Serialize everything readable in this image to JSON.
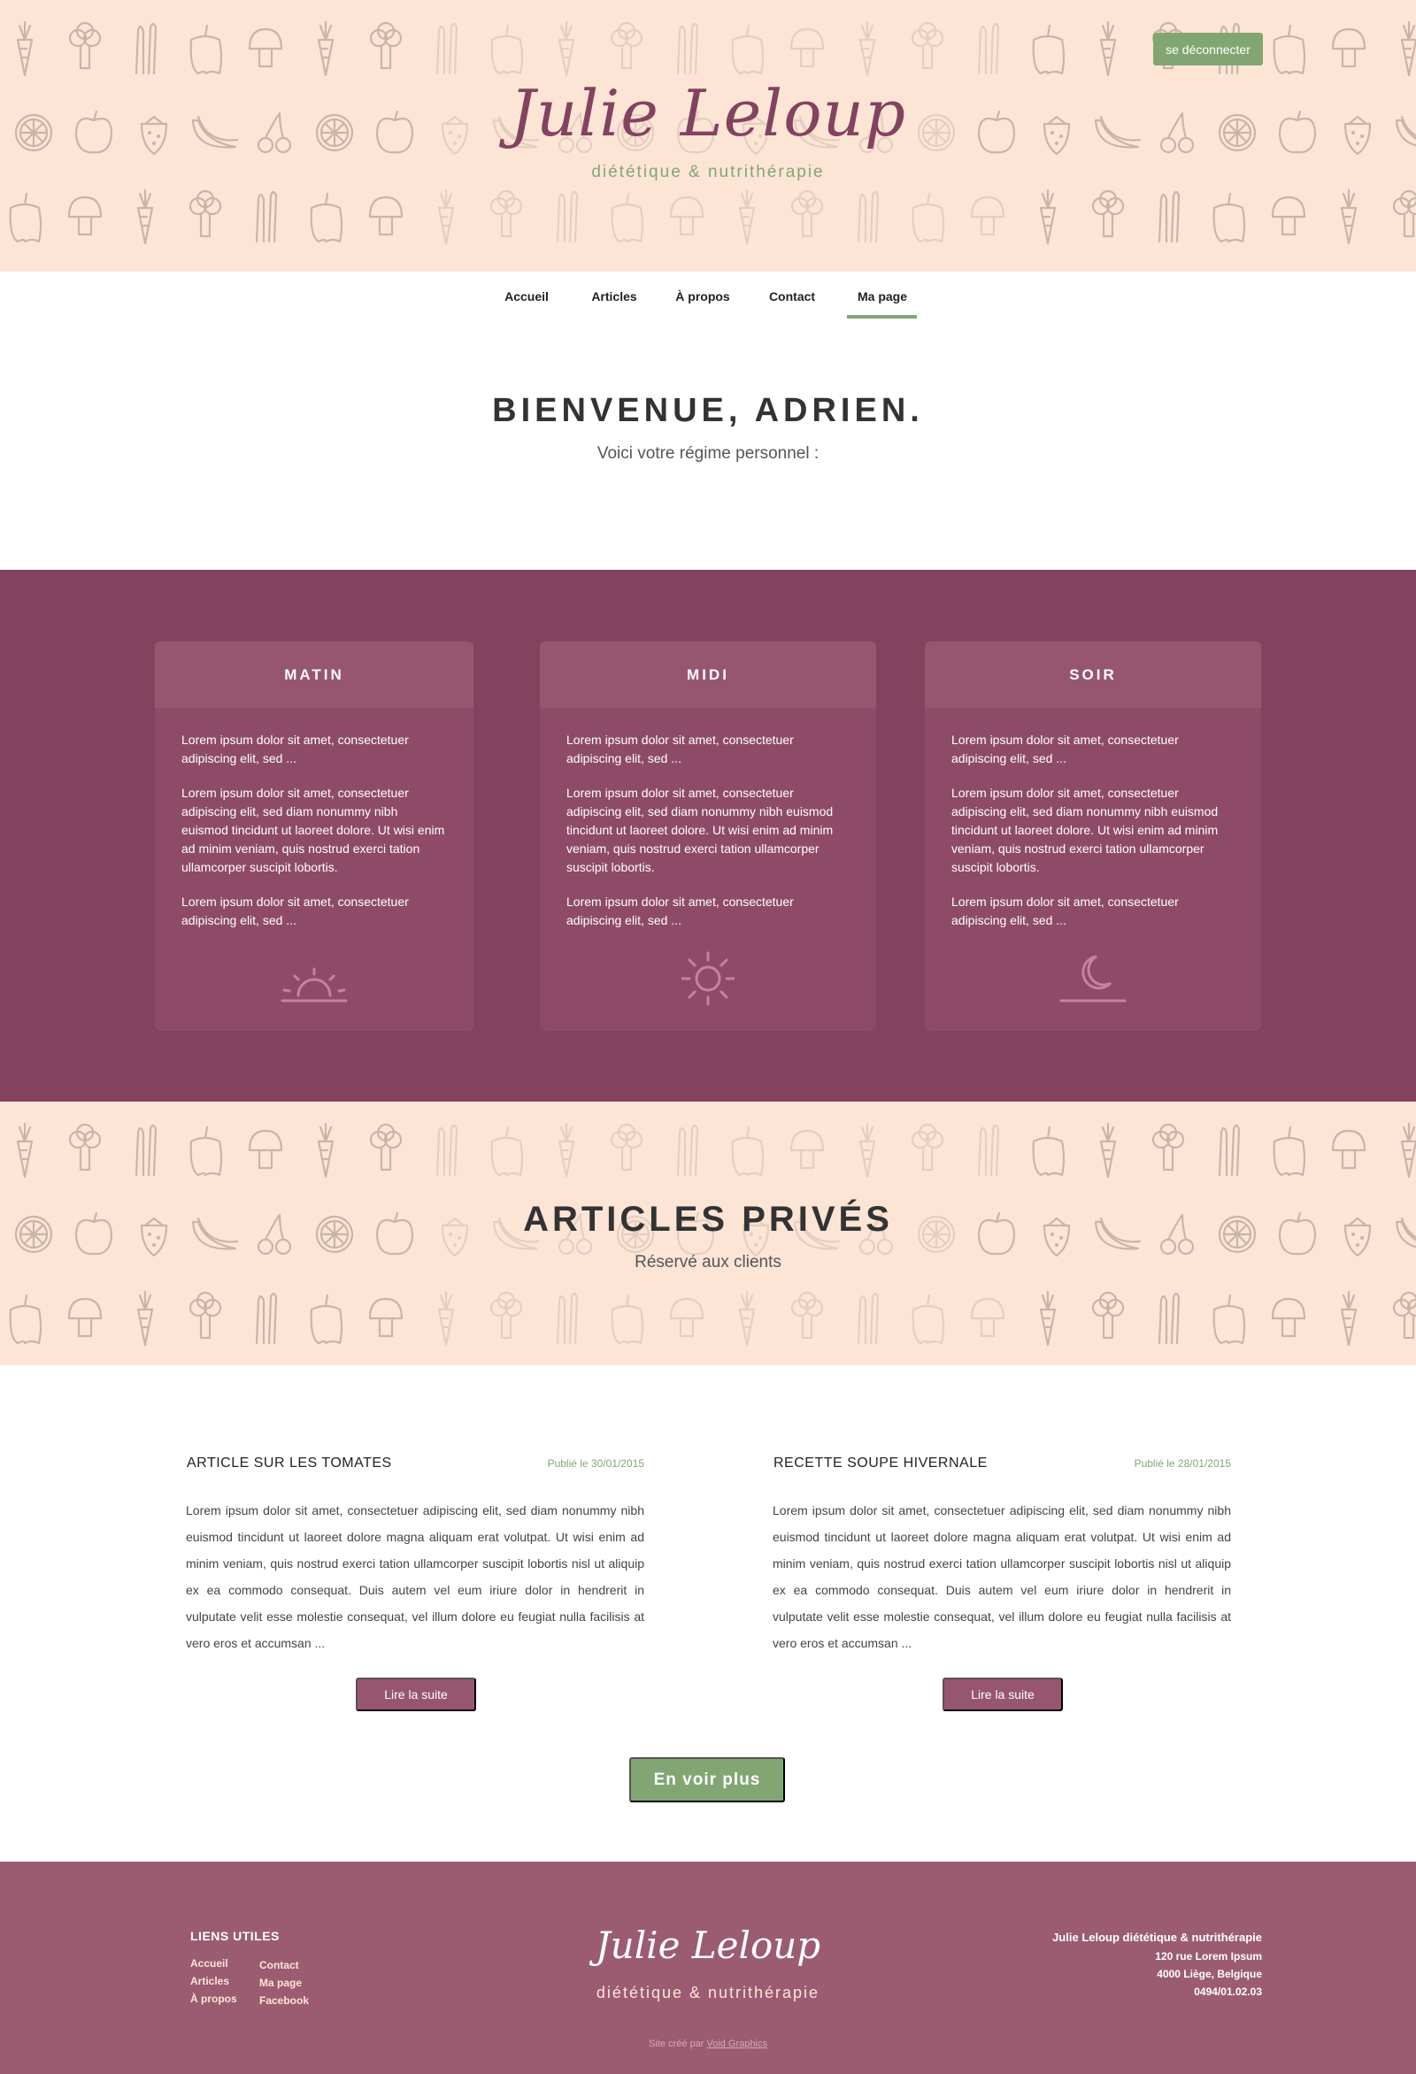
{
  "header": {
    "logout_label": "se déconnecter",
    "logo": "Julie Leloup",
    "tagline": "diététique & nutrithérapie"
  },
  "nav": {
    "items": [
      {
        "label": "Accueil"
      },
      {
        "label": "Articles"
      },
      {
        "label": "À propos"
      },
      {
        "label": "Contact"
      },
      {
        "label": "Ma page",
        "active": true
      }
    ]
  },
  "welcome": {
    "title": "BIENVENUE, ADRIEN.",
    "subtitle": "Voici votre régime personnel :"
  },
  "diet": {
    "meals": [
      {
        "title": "MATIN",
        "icon": "sunrise-icon",
        "paragraphs": [
          "Lorem ipsum dolor sit amet, consectetuer adipiscing elit, sed ...",
          "Lorem ipsum dolor sit amet, consectetuer adipiscing elit, sed diam nonummy nibh euismod tincidunt ut laoreet dolore. Ut wisi enim ad minim veniam, quis nostrud exerci tation ullamcorper suscipit lobortis.",
          "Lorem ipsum dolor sit amet, consectetuer adipiscing elit, sed ..."
        ]
      },
      {
        "title": "MIDI",
        "icon": "sun-icon",
        "paragraphs": [
          "Lorem ipsum dolor sit amet, consectetuer adipiscing elit, sed ...",
          "Lorem ipsum dolor sit amet, consectetuer adipiscing elit, sed diam nonummy nibh euismod tincidunt ut laoreet dolore. Ut wisi enim ad minim veniam, quis nostrud exerci tation ullamcorper suscipit lobortis.",
          "Lorem ipsum dolor sit amet, consectetuer adipiscing elit, sed ..."
        ]
      },
      {
        "title": "SOIR",
        "icon": "moon-icon",
        "paragraphs": [
          "Lorem ipsum dolor sit amet, consectetuer adipiscing elit, sed ...",
          "Lorem ipsum dolor sit amet, consectetuer adipiscing elit, sed diam nonummy nibh euismod tincidunt ut laoreet dolore. Ut wisi enim ad minim veniam, quis nostrud exerci tation ullamcorper suscipit lobortis.",
          "Lorem ipsum dolor sit amet, consectetuer adipiscing elit, sed ..."
        ]
      }
    ]
  },
  "articles_section": {
    "title": "ARTICLES PRIVÉS",
    "subtitle": "Réservé aux clients"
  },
  "articles": [
    {
      "title": "ARTICLE SUR LES TOMATES",
      "date": "Publié le 30/01/2015",
      "text": "Lorem ipsum dolor sit amet, consectetuer adipiscing elit, sed diam nonummy nibh euismod tincidunt ut laoreet dolore magna aliquam erat volutpat. Ut wisi enim ad minim veniam, quis nostrud exerci tation ullamcorper suscipit lobortis nisl ut aliquip ex ea commodo consequat. Duis autem vel eum iriure dolor in hendrerit in vulputate velit esse molestie consequat, vel illum dolore eu feugiat nulla facilisis at vero eros et accumsan ...",
      "button": "Lire la suite"
    },
    {
      "title": "RECETTE SOUPE HIVERNALE",
      "date": "Publié le 28/01/2015",
      "text": "Lorem ipsum dolor sit amet, consectetuer adipiscing elit, sed diam nonummy nibh euismod tincidunt ut laoreet dolore magna aliquam erat volutpat. Ut wisi enim ad minim veniam, quis nostrud exerci tation ullamcorper suscipit lobortis nisl ut aliquip ex ea commodo consequat. Duis autem vel eum iriure dolor in hendrerit in vulputate velit esse molestie consequat, vel illum dolore eu feugiat nulla facilisis at vero eros et accumsan ...",
      "button": "Lire la suite"
    }
  ],
  "see_more_label": "En voir plus",
  "footer": {
    "links_title": "LIENS UTILES",
    "links_col1": [
      "Accueil",
      "Articles",
      "À propos"
    ],
    "links_col2": [
      "Contact",
      "Ma page",
      "Facebook"
    ],
    "logo": "Julie Leloup",
    "tagline": "diététique & nutrithérapie",
    "company": "Julie Leloup diététique & nutrithérapie",
    "address1": "120 rue Lorem Ipsum",
    "address2": "4000 Liège, Belgique",
    "phone": "0494/01.02.03",
    "credit_prefix": "Site créé par",
    "credit_link": "Void Graphics"
  },
  "colors": {
    "plum": "#83435f",
    "card": "#8e4b67",
    "green": "#82a673",
    "peach": "#fde5d6",
    "footer": "#9b5c71"
  }
}
